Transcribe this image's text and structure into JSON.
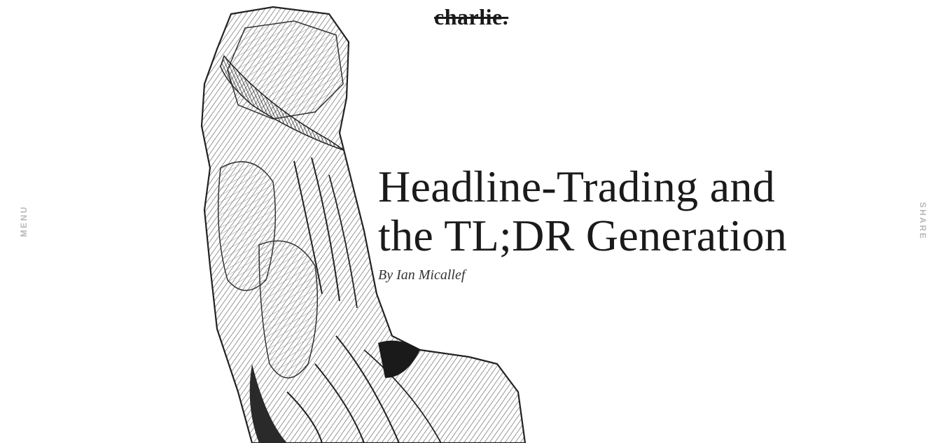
{
  "header": {
    "logo_text": "charlie."
  },
  "nav": {
    "menu_label": "MENU",
    "share_label": "SHARE"
  },
  "article": {
    "title_line1": "Headline-Trading and",
    "title_line2": "the TL;DR Generation",
    "byline": "By Ian Micallef"
  },
  "hero": {
    "icon": "classical-statue-engraving"
  },
  "colors": {
    "text": "#1a1a1a",
    "muted": "#b8b8b8",
    "background": "#ffffff"
  }
}
